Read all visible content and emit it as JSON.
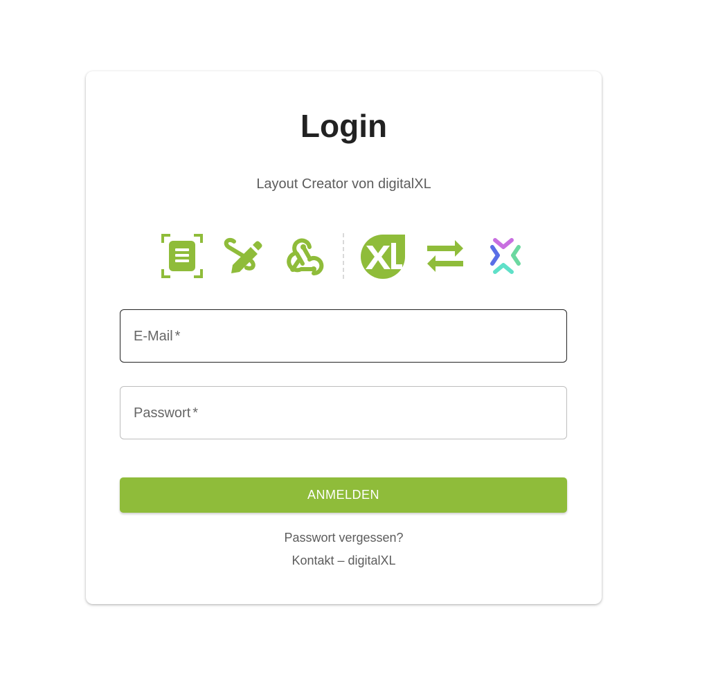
{
  "login": {
    "title": "Login",
    "subtitle": "Layout Creator von digitalXL",
    "icons": [
      "document-scan-icon",
      "pencil-edit-icon",
      "webhook-icon",
      "digitalxl-logo-icon",
      "swap-arrows-icon",
      "x-brackets-logo-icon"
    ],
    "email_label": "E-Mail",
    "password_label": "Passwort",
    "required_mark": "*",
    "submit_label": "ANMELDEN",
    "forgot_link": "Passwort vergessen?",
    "contact_link": "Kontakt – digitalXL"
  },
  "colors": {
    "accent": "#8fbc3a",
    "text": "#222222",
    "muted": "#5c5c5c"
  }
}
